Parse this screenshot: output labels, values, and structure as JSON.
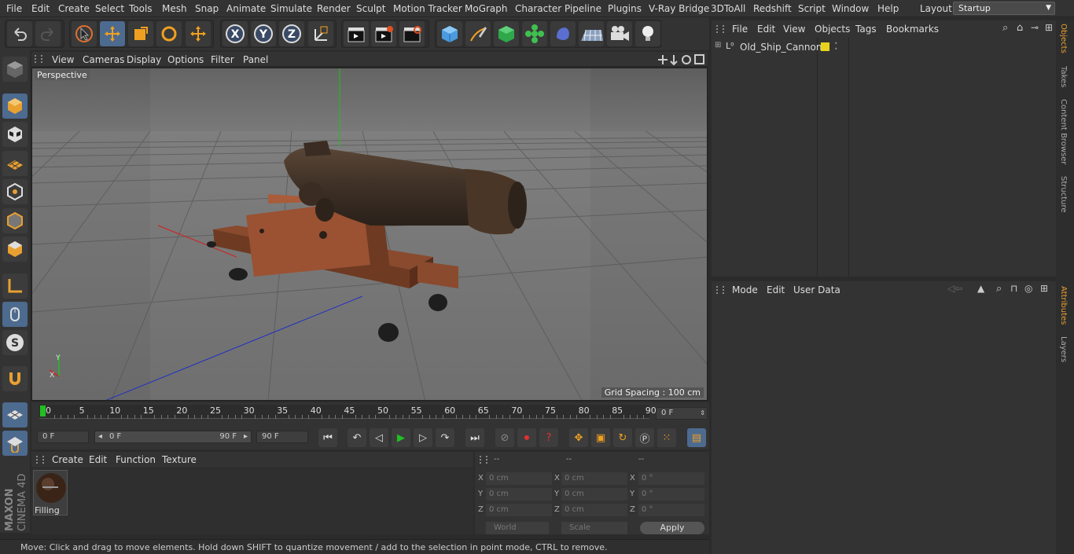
{
  "menu": [
    "File",
    "Edit",
    "Create",
    "Select",
    "Tools",
    "Mesh",
    "Snap",
    "Animate",
    "Simulate",
    "Render",
    "Sculpt",
    "Motion Tracker",
    "MoGraph",
    "Character",
    "Pipeline",
    "Plugins",
    "V-Ray Bridge",
    "3DToAll",
    "Redshift",
    "Script",
    "Window",
    "Help"
  ],
  "layout": {
    "label": "Layout:",
    "value": "Startup"
  },
  "viewport": {
    "menu": [
      "View",
      "Cameras",
      "Display",
      "Options",
      "Filter",
      "Panel"
    ],
    "label": "Perspective",
    "grid_spacing": "Grid Spacing : 100 cm",
    "axis_x": "X",
    "axis_y": "Y",
    "axis_z": "Z"
  },
  "timeline": {
    "ticks": [
      "0",
      "5",
      "10",
      "15",
      "20",
      "25",
      "30",
      "35",
      "40",
      "45",
      "50",
      "55",
      "60",
      "65",
      "70",
      "75",
      "80",
      "85",
      "90"
    ],
    "frame_field": "0 F",
    "start": "0 F",
    "range_start": "0 F",
    "range_end": "90 F",
    "end": "90 F"
  },
  "material_panel": {
    "menu": [
      "Create",
      "Edit",
      "Function",
      "Texture"
    ],
    "material_name": "Filling"
  },
  "coord": {
    "headers": [
      "--",
      "--",
      "--"
    ],
    "rows": [
      {
        "a": "X",
        "av": "0 cm",
        "b": "X",
        "bv": "0 cm",
        "c": "X",
        "cv": "0 °"
      },
      {
        "a": "Y",
        "av": "0 cm",
        "b": "Y",
        "bv": "0 cm",
        "c": "Y",
        "cv": "0 °"
      },
      {
        "a": "Z",
        "av": "0 cm",
        "b": "Z",
        "bv": "0 cm",
        "c": "Z",
        "cv": "0 °"
      }
    ],
    "mode": "World",
    "scale": "Scale",
    "apply": "Apply"
  },
  "status": "Move: Click and drag to move elements. Hold down SHIFT to quantize movement / add to the selection in point mode, CTRL to remove.",
  "objects": {
    "menu": [
      "File",
      "Edit",
      "View",
      "Objects",
      "Tags",
      "Bookmarks"
    ],
    "item": "Old_Ship_Cannon",
    "layer_color": "#e8d21c"
  },
  "attributes": {
    "menu": [
      "Mode",
      "Edit",
      "User Data"
    ]
  },
  "right_tabs": [
    "Objects",
    "Takes",
    "Content Browser",
    "Structure",
    "Attributes",
    "Layers"
  ],
  "brand": {
    "line1": "MAXON",
    "line2": "CINEMA 4D"
  },
  "colors": {
    "accent": "#4d6a8f",
    "axis_x": "#d02020",
    "axis_y": "#20c020",
    "axis_z": "#2030c0",
    "cannon_wood": "#8a4a2e"
  }
}
